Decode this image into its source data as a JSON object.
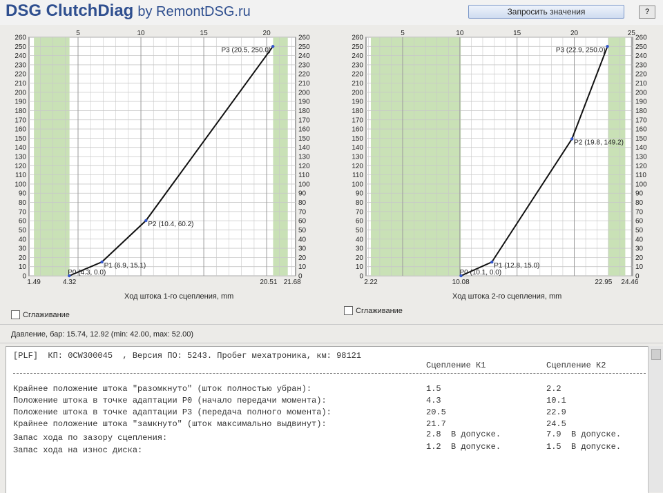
{
  "app": {
    "title": "DSG ClutchDiag",
    "subtitle": "by RemontDSG.ru",
    "request_button": "Запросить значения",
    "help_button": "?"
  },
  "smoothing_label": "Сглаживание",
  "status": "Давление, бар: 15.74, 12.92 (min: 42.00, max: 52.00)",
  "chart_data": [
    {
      "type": "line",
      "xlabel": "Ход штока 1-го сцепления, mm",
      "xlim": [
        1.1,
        22.3
      ],
      "ylim": [
        0,
        260
      ],
      "x_ticks_top": [
        5,
        10,
        15,
        20
      ],
      "y_ticks": [
        0,
        10,
        20,
        30,
        40,
        50,
        60,
        70,
        80,
        90,
        100,
        110,
        120,
        130,
        140,
        150,
        160,
        170,
        180,
        190,
        200,
        210,
        220,
        230,
        240,
        250,
        260
      ],
      "bottom_marks": [
        "1.49",
        "4.32",
        "20.51",
        "21.68"
      ],
      "green_zones": [
        [
          1.49,
          4.32
        ],
        [
          20.51,
          21.68
        ]
      ],
      "grid": true,
      "series": [
        {
          "values": [
            [
              4.3,
              0.0
            ],
            [
              6.9,
              15.1
            ],
            [
              10.4,
              60.2
            ],
            [
              20.5,
              250.0
            ]
          ]
        }
      ],
      "annotations": [
        "P0 (4.3, 0.0)",
        "P1 (6.9, 15.1)",
        "P2 (10.4, 60.2)",
        "P3 (20.5, 250.0)"
      ]
    },
    {
      "type": "line",
      "xlabel": "Ход штока 2-го сцепления, mm",
      "xlim": [
        1.8,
        25.1
      ],
      "ylim": [
        0,
        260
      ],
      "x_ticks_top": [
        5,
        10,
        15,
        20,
        25
      ],
      "y_ticks": [
        0,
        10,
        20,
        30,
        40,
        50,
        60,
        70,
        80,
        90,
        100,
        110,
        120,
        130,
        140,
        150,
        160,
        170,
        180,
        190,
        200,
        210,
        220,
        230,
        240,
        250,
        260
      ],
      "bottom_marks": [
        "2.22",
        "10.08",
        "22.95",
        "24.46"
      ],
      "green_zones": [
        [
          2.22,
          10.08
        ],
        [
          22.95,
          24.46
        ]
      ],
      "grid": true,
      "series": [
        {
          "values": [
            [
              10.1,
              0.0
            ],
            [
              12.8,
              15.0
            ],
            [
              19.8,
              149.2
            ],
            [
              22.9,
              250.0
            ]
          ]
        }
      ],
      "annotations": [
        "P0 (10.1, 0.0)",
        "P1 (12.8, 15.0)",
        "P2 (19.8, 149.2)",
        "P3 (22.9, 250.0)"
      ]
    }
  ],
  "report": {
    "lines": [
      "[PLF]  КП: 0CW300045  , Версия ПО: 5243. Пробег мехатроника, км: 98121",
      "Крайнее положение штока \"разомкнуто\" (шток полностью убран):",
      "Положение штока в точке адаптации P0 (начало передачи момента):",
      "Положение штока в точке адаптации P3 (передача полного момента):",
      "Крайнее положение штока \"замкнуто\" (шток максимально выдвинут):",
      "Запас хода по зазору сцепления:",
      "Запас хода на износ диска:"
    ],
    "col1_header": "Сцепление К1",
    "col2_header": "Сцепление К2",
    "col1_values": [
      "1.5",
      "4.3",
      "20.5",
      "21.7",
      "2.8  В допуске.",
      "1.2  В допуске."
    ],
    "col2_values": [
      "2.2",
      "10.1",
      "22.9",
      "24.5",
      "7.9  В допуске.",
      "1.5  В допуске."
    ]
  },
  "colors": {
    "green_zone": "#c9e1b6",
    "curve": "#111111",
    "point": "#3355cc",
    "grid": "#c8c8c8",
    "title_blue": "#2f4f8f"
  }
}
